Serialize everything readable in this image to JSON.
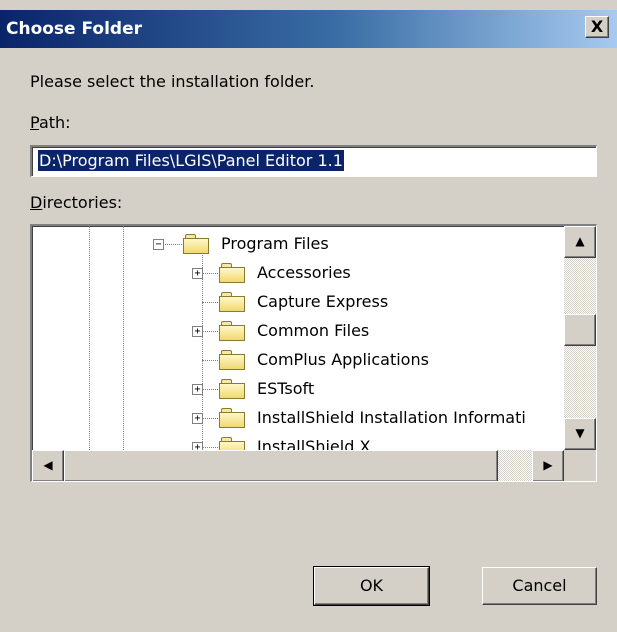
{
  "window": {
    "title": "Choose Folder",
    "close_glyph": "X"
  },
  "prompt": "Please select the installation folder.",
  "path": {
    "label": "Path:",
    "value": "D:\\Program Files\\LGIS\\Panel Editor 1.1"
  },
  "directories": {
    "label": "Directories:",
    "root": {
      "label": "Program Files",
      "expander": "−",
      "icon": "folder-open-icon"
    },
    "items": [
      {
        "label": "Accessories",
        "expander": "+",
        "icon": "folder-icon"
      },
      {
        "label": "Capture Express",
        "expander": "",
        "icon": "folder-icon"
      },
      {
        "label": "Common Files",
        "expander": "+",
        "icon": "folder-icon"
      },
      {
        "label": "ComPlus Applications",
        "expander": "",
        "icon": "folder-icon"
      },
      {
        "label": "ESTsoft",
        "expander": "+",
        "icon": "folder-icon"
      },
      {
        "label": "InstallShield Installation Informati",
        "expander": "+",
        "icon": "folder-icon"
      },
      {
        "label": "InstallShield X",
        "expander": "+",
        "icon": "folder-icon"
      }
    ],
    "scroll": {
      "up_glyph": "▲",
      "down_glyph": "▼",
      "left_glyph": "◀",
      "right_glyph": "▶"
    }
  },
  "buttons": {
    "ok": "OK",
    "cancel": "Cancel"
  },
  "colors": {
    "title_start": "#0a246a",
    "title_end": "#a6caf0",
    "selection": "#0a246a",
    "face": "#d4d0c8"
  }
}
